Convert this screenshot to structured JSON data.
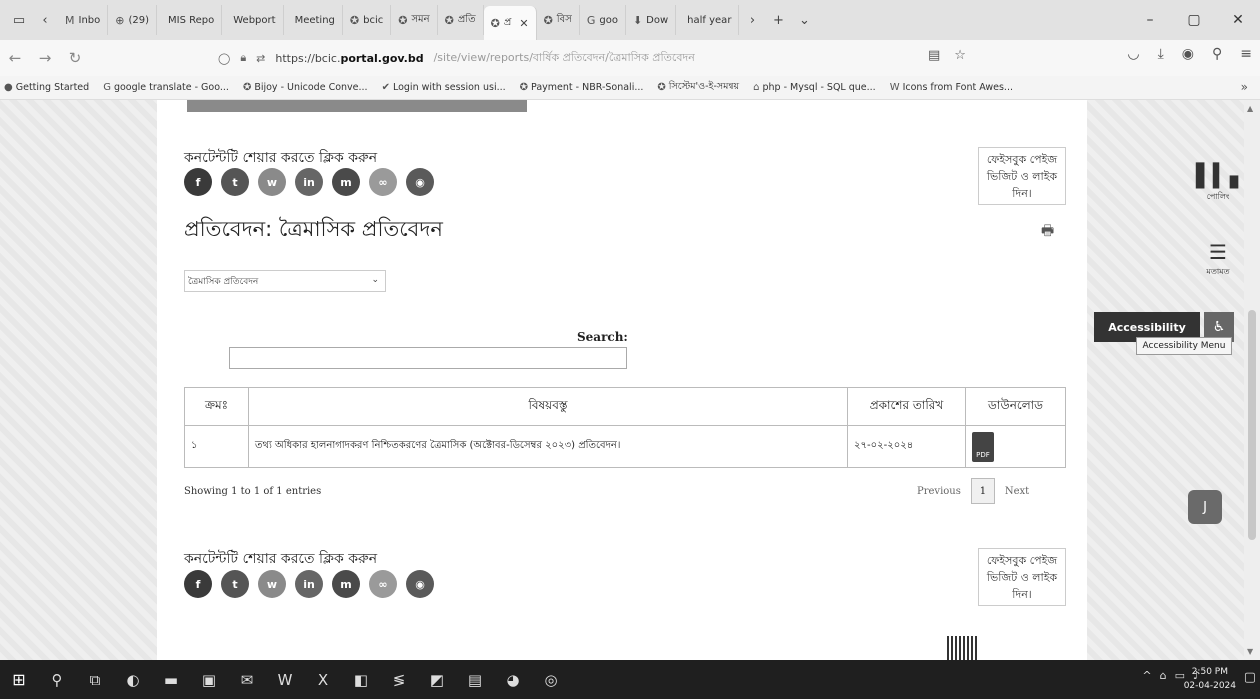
{
  "browser": {
    "tabs": [
      {
        "icon": "M",
        "label": "Inbo"
      },
      {
        "icon": "⊕",
        "label": "(29)"
      },
      {
        "icon": "",
        "label": "MIS Repo"
      },
      {
        "icon": "",
        "label": "Webport"
      },
      {
        "icon": "",
        "label": "Meeting"
      },
      {
        "icon": "✪",
        "label": "bcic"
      },
      {
        "icon": "✪",
        "label": "সমন"
      },
      {
        "icon": "✪",
        "label": "প্রতি"
      },
      {
        "icon": "✪",
        "label": "প্র",
        "active": true
      },
      {
        "icon": "✪",
        "label": "বিস"
      },
      {
        "icon": "G",
        "label": "goo"
      },
      {
        "icon": "⬇",
        "label": "Dow"
      },
      {
        "icon": "",
        "label": "half year"
      }
    ],
    "url_host": "https://bcic.portal.gov.bd",
    "url_host_bold": "portal.gov.bd",
    "url_prefix": "https://bcic.",
    "url_path": "/site/view/reports/বার্ষিক প্রতিবেদন/ত্রৈমাসিক প্রতিবেদন",
    "bookmarks": [
      {
        "icon": "●",
        "label": "Getting Started"
      },
      {
        "icon": "G",
        "label": "google translate - Goo..."
      },
      {
        "icon": "✪",
        "label": "Bijoy - Unicode Conve..."
      },
      {
        "icon": "✔",
        "label": "Login with session usi..."
      },
      {
        "icon": "✪",
        "label": "Payment - NBR-Sonali..."
      },
      {
        "icon": "✪",
        "label": "সিস্টেম'ও-ই-সমন্বয়"
      },
      {
        "icon": "⌂",
        "label": "php - Mysql - SQL que..."
      },
      {
        "icon": "W",
        "label": "Icons from Font Awes..."
      }
    ]
  },
  "page": {
    "share_label": "কনটেন্টটি শেয়ার করতে ক্লিক করুন",
    "social": [
      {
        "name": "facebook",
        "glyph": "f",
        "color": "#3a3a3a"
      },
      {
        "name": "twitter",
        "glyph": "t",
        "color": "#555555"
      },
      {
        "name": "whatsapp",
        "glyph": "w",
        "color": "#8a8a8a"
      },
      {
        "name": "linkedin",
        "glyph": "in",
        "color": "#666666"
      },
      {
        "name": "messenger",
        "glyph": "m",
        "color": "#4a4a4a"
      },
      {
        "name": "link",
        "glyph": "∞",
        "color": "#9a9a9a"
      },
      {
        "name": "chat",
        "glyph": "◉",
        "color": "#5a5a5a"
      }
    ],
    "fb_box": "ফেইসবুক পেইজ ভিজিট ও লাইক দিন।",
    "title": "প্রতিবেদন: ত্রৈমাসিক প্রতিবেদন",
    "select_value": "ত্রৈমাসিক প্রতিবেদন",
    "search_label": "Search:",
    "table": {
      "headers": [
        "ক্রমঃ",
        "বিষয়বস্তু",
        "প্রকাশের তারিখ",
        "ডাউনলোড"
      ],
      "rows": [
        {
          "serial": "১",
          "subject": "তথ্য অধিকার হালনাগাদকরণ নিশ্চিতকরণের ত্রৈমাসিক (অক্টোবর-ডিসেম্বর ২০২৩) প্রতিবেদন।",
          "date": "২৭-০২-২০২৪",
          "download": "PDF"
        }
      ]
    },
    "info": "Showing 1 to 1 of 1 entries",
    "pager": {
      "previous": "Previous",
      "current": "1",
      "next": "Next"
    }
  },
  "side": {
    "poll_label": "পোলিং",
    "opinion_label": "মতামত",
    "accessibility": "Accessibility",
    "accessibility_tip": "Accessibility Menu"
  },
  "taskbar": {
    "time": "2:50 PM",
    "date": "02-04-2024"
  },
  "colors": {
    "taskbar": "#1f1f1f",
    "accessibility": "#333333"
  }
}
